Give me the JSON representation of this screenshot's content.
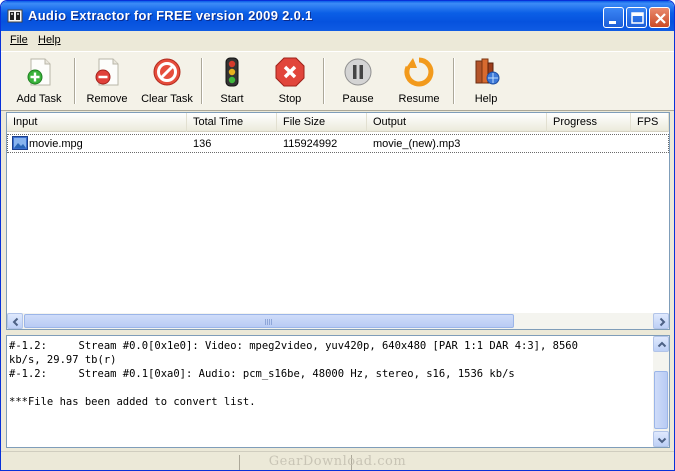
{
  "window": {
    "title": "Audio Extractor for FREE version 2009  2.0.1"
  },
  "menu": {
    "file": "File",
    "help": "Help"
  },
  "toolbar": {
    "add_task": "Add Task",
    "remove": "Remove",
    "clear_task": "Clear Task",
    "start": "Start",
    "stop": "Stop",
    "pause": "Pause",
    "resume": "Resume",
    "help": "Help"
  },
  "list": {
    "columns": [
      "Input",
      "Total Time",
      "File Size",
      "Output",
      "Progress",
      "FPS"
    ],
    "rows": [
      {
        "input": "movie.mpg",
        "total_time": "136",
        "file_size": "115924992",
        "output": "movie_(new).mp3",
        "progress": "",
        "fps": ""
      }
    ]
  },
  "log": {
    "lines": [
      "#-1.2:     Stream #0.0[0x1e0]: Video: mpeg2video, yuv420p, 640x480 [PAR 1:1 DAR 4:3], 8560",
      "kb/s, 29.97 tb(r)",
      "#-1.2:     Stream #0.1[0xa0]: Audio: pcm_s16be, 48000 Hz, stereo, s16, 1536 kb/s",
      "",
      "***File has been added to convert list."
    ]
  },
  "watermark": "GearDownload.com",
  "icons": {
    "add_task": "add-document-icon",
    "remove": "remove-document-icon",
    "clear_task": "no-entry-icon",
    "start": "traffic-light-icon",
    "stop": "stop-x-icon",
    "pause": "pause-icon",
    "resume": "resume-arrow-icon",
    "help": "help-books-icon"
  },
  "colors": {
    "titlebar": "#0b5fe6",
    "selection_border": "#6b6b6b"
  }
}
